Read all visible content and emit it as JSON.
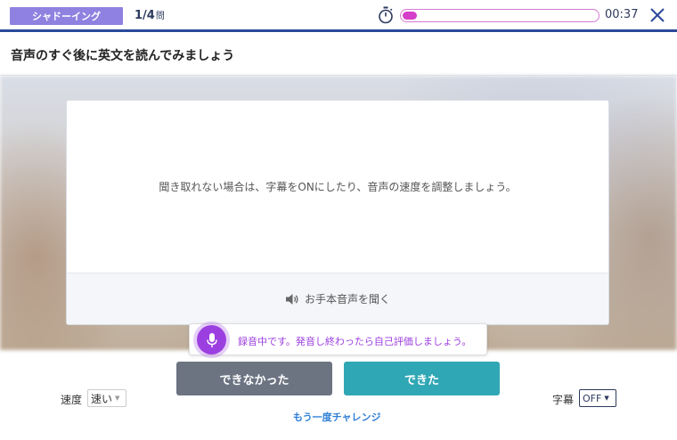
{
  "header": {
    "mode_label": "シャドーイング",
    "question_current_total": "1/4",
    "question_unit": "問",
    "progress_fraction": 0.07,
    "time": "00:37"
  },
  "instruction": "音声のすぐ後に英文を読んでみましょう",
  "card": {
    "message": "聞き取れない場合は、字幕をONにしたり、音声の速度を調整しましょう。",
    "listen_label": "お手本音声を聞く"
  },
  "recording": {
    "message": "録音中です。発音し終わったら自己評価しましょう。"
  },
  "controls": {
    "fail_label": "できなかった",
    "ok_label": "できた",
    "retry_label": "もう一度チャレンジ",
    "speed_label": "速度",
    "speed_value": "速い",
    "subtitle_label": "字幕",
    "subtitle_value": "OFF"
  },
  "colors": {
    "badge": "#8f81e0",
    "progress": "#d63fc9",
    "header_border": "#2a4a9a",
    "fail_button": "#6c7482",
    "ok_button": "#30a7b5",
    "mic": "#9c3fe0",
    "link": "#2f7fd6"
  },
  "icons": {
    "timer": "stopwatch-icon",
    "close": "close-icon",
    "speaker": "speaker-icon",
    "mic": "microphone-icon"
  }
}
